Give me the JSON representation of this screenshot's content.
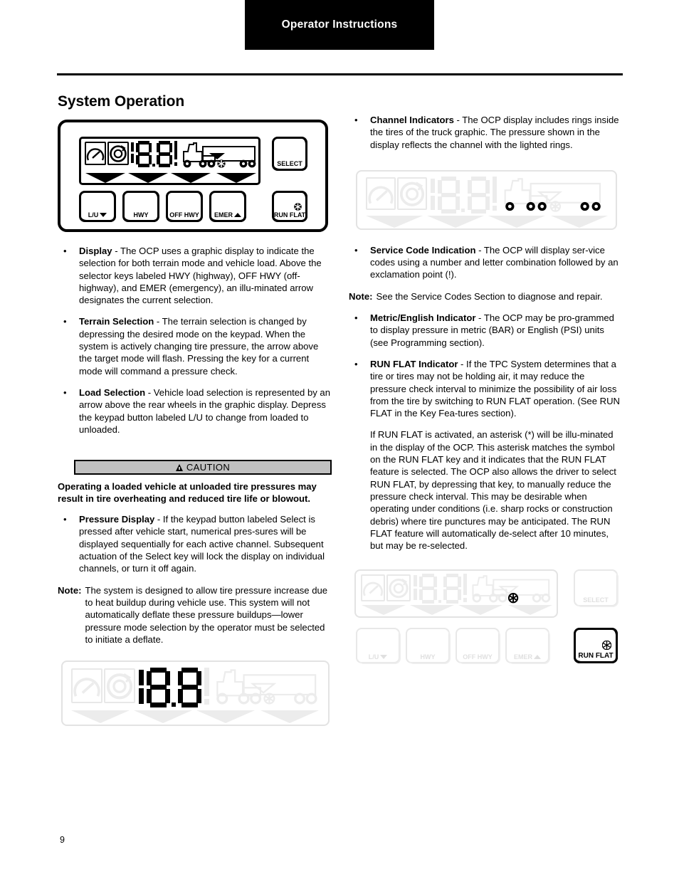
{
  "header": {
    "banner_title": "Operator Instructions"
  },
  "page": {
    "title": "System Operation",
    "number": "9"
  },
  "device_panels": {
    "panel_top": {
      "keys": [
        {
          "label": "L/U",
          "icon": "triangle-down-icon"
        },
        {
          "label": "HWY",
          "icon": ""
        },
        {
          "label": "OFF HWY",
          "icon": ""
        },
        {
          "label": "EMER",
          "icon": "triangle-up-icon"
        }
      ],
      "select_label": "SELECT",
      "run_flat_label": "RUN FLAT",
      "run_flat_icon": "asterisk-icon",
      "display_digits": "88",
      "display_exclamation": "!",
      "gauge_icon": "pressure-gauge-icon",
      "tire_icon": "tire-rotation-icon"
    },
    "panel_channel": {
      "caption_ref": "channel-indicators",
      "display_digits": "88",
      "highlight": "tire-rings"
    },
    "panel_pressure": {
      "caption_ref": "pressure-display",
      "display_digits": "88",
      "highlight": "digits"
    },
    "panel_runflat": {
      "keys": [
        {
          "label": "L/U",
          "icon": "triangle-down-icon"
        },
        {
          "label": "HWY",
          "icon": ""
        },
        {
          "label": "OFF HWY",
          "icon": ""
        },
        {
          "label": "EMER",
          "icon": "triangle-up-icon"
        }
      ],
      "select_label": "SELECT",
      "run_flat_label": "RUN FLAT",
      "run_flat_icon": "asterisk-icon",
      "display_digits": "88",
      "highlight": "run-flat-key"
    }
  },
  "left_column": {
    "bullets": [
      {
        "dot": "•",
        "term": "Display",
        "text": " - The OCP uses a graphic display to indicate the selection for both terrain mode and vehicle load. Above the selector keys labeled HWY (highway), OFF HWY (off-highway), and EMER (emergency), an illu-minated arrow designates the current selection."
      },
      {
        "dot": "•",
        "term": "Terrain Selection",
        "text": " - The terrain selection is changed by depressing the desired mode on the keypad. When the system is actively changing tire pressure, the arrow above the target mode will flash. Pressing the key for a current mode will command a pressure check."
      },
      {
        "dot": "•",
        "term": "Load Selection",
        "text": " - Vehicle load selection is represented by an arrow above the rear wheels in the graphic display. Depress the keypad button labeled L/U to change from loaded to unloaded."
      }
    ],
    "caution": {
      "label": "CAUTION",
      "icon": "warning-triangle-icon",
      "text": "Operating a loaded vehicle at unloaded tire pressures may result in tire overheating and reduced tire life or blowout."
    },
    "bullets2": [
      {
        "dot": "•",
        "term": "Pressure Display",
        "text": " - If the keypad button labeled Select is pressed after vehicle start, numerical pres-sures will be displayed sequentially for each active channel. Subsequent actuation of the Select key will lock the display on individual channels, or turn it off again."
      }
    ],
    "note": {
      "label": "Note:",
      "text": "The system is designed to allow tire pressure increase due to heat buildup during vehicle use. This system will not automatically deflate these pressure buildups—lower pressure mode selection by the operator must be selected to initiate a deflate."
    }
  },
  "right_column": {
    "bullets": [
      {
        "dot": "•",
        "term": "Channel Indicators",
        "text": " - The OCP display includes rings inside the tires of the truck graphic. The pressure shown in the display reflects the channel with the lighted rings."
      },
      {
        "dot": "•",
        "term": "Service Code Indication",
        "text": " - The OCP will display ser-vice codes using a number and letter combination followed by an exclamation point (!)."
      }
    ],
    "note": {
      "label": "Note:",
      "text": "See the Service Codes Section to diagnose and repair."
    },
    "bullets2": [
      {
        "dot": "•",
        "term": "Metric/English Indicator",
        "text": " - The OCP may be pro-grammed to display pressure in metric (BAR) or English (PSI) units (see Programming section)."
      },
      {
        "dot": "•",
        "term": "RUN FLAT Indicator",
        "text": " - If the TPC System determines that a tire or tires may not be holding air, it may reduce the pressure check interval to minimize the possibility of air loss from the tire by switching to RUN FLAT operation. (See RUN FLAT in the Key Fea-tures section)."
      }
    ],
    "paragraph": "If RUN FLAT is activated, an asterisk (*) will be illu-minated in the display of the OCP. This asterisk matches the symbol on the RUN FLAT key and it indicates that the RUN FLAT feature is selected. The OCP also allows the driver to select RUN FLAT, by depressing that key, to manually reduce the pressure check interval. This may be desirable when operating under conditions (i.e. sharp rocks or construction debris) where tire punctures may be anticipated. The RUN FLAT feature will automatically de-select after 10 minutes, but may be re-selected."
  },
  "colors": {
    "banner_bg": "#000000",
    "banner_fg": "#ffffff",
    "caution_bg": "#c0c0c0",
    "ghost": "#ececec",
    "ink": "#000000"
  }
}
